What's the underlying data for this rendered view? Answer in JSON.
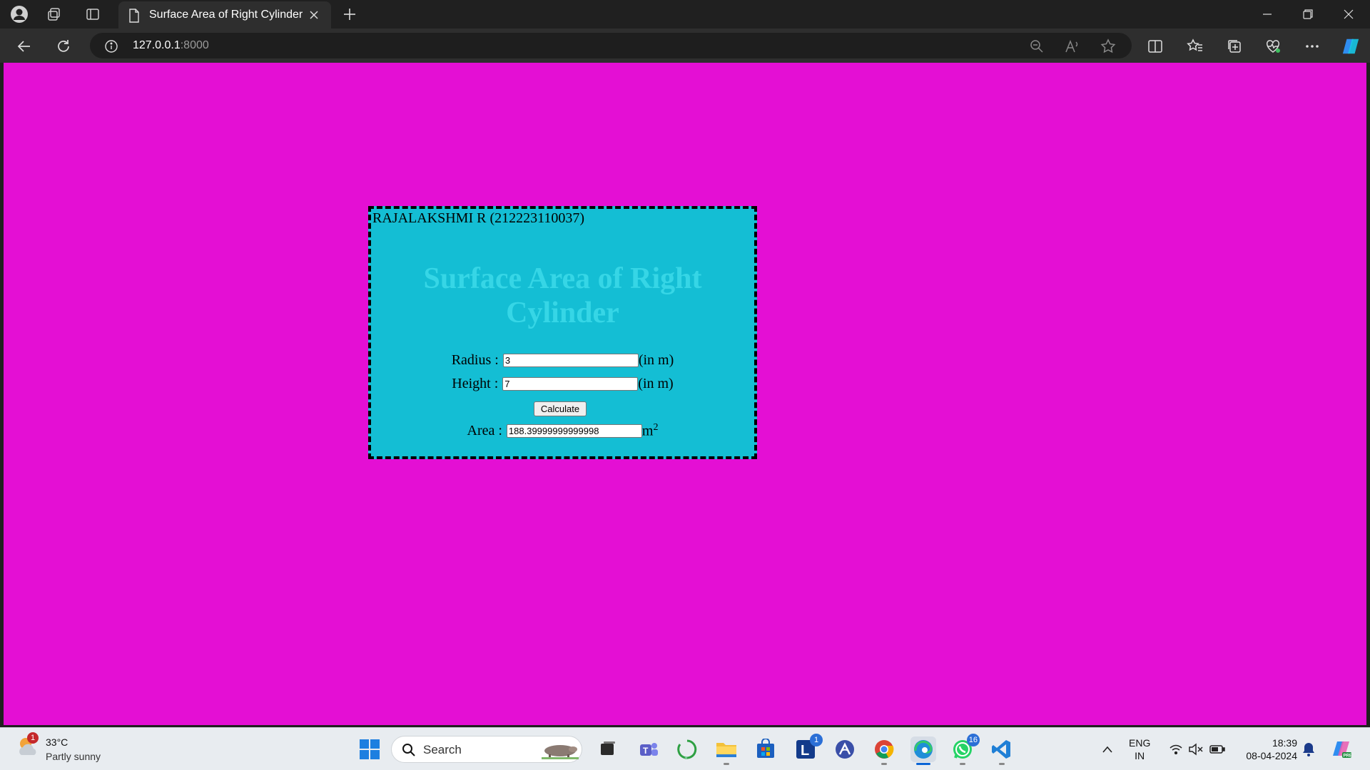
{
  "browser": {
    "tab_title": "Surface Area of Right Cylinder",
    "url_host": "127.0.0.1",
    "url_port": ":8000"
  },
  "page": {
    "author": "RAJALAKSHMI R (212223110037)",
    "heading": "Surface Area of Right Cylinder",
    "radius_label": "Radius :",
    "radius_value": "3",
    "radius_unit": "(in m)",
    "height_label": "Height :",
    "height_value": "7",
    "height_unit": "(in m)",
    "calculate_label": "Calculate",
    "area_label": "Area :",
    "area_value": "188.39999999999998",
    "area_unit": "m",
    "area_unit_sup": "2",
    "background_color": "#e40fd4",
    "card_color": "#14bed4",
    "heading_color": "#36d6e6"
  },
  "taskbar": {
    "weather_temp": "33°C",
    "weather_condition": "Partly sunny",
    "weather_badge": "1",
    "search_placeholder": "Search",
    "lens_badge": "1",
    "whatsapp_badge": "16",
    "lang_top": "ENG",
    "lang_bottom": "IN",
    "time": "18:39",
    "date": "08-04-2024"
  }
}
